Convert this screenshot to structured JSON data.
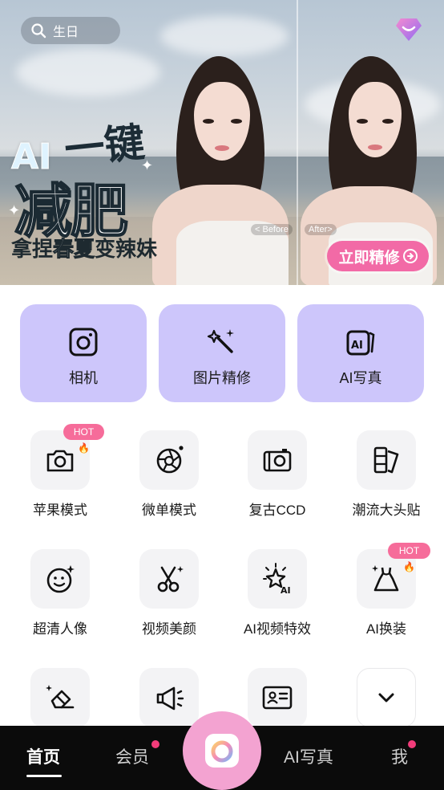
{
  "search": {
    "placeholder": "生日",
    "icon": "search-icon"
  },
  "vip": {
    "icon": "diamond-icon",
    "color": "#b86cf2"
  },
  "banner": {
    "headline_ai": "AI",
    "headline_jian": "一键",
    "headline_main": "减肥",
    "headline_sub_a": "拿捏",
    "headline_sub_b": "春夏",
    "headline_sub_c": "变",
    "headline_sub_d": "辣妹",
    "before_tag": "< Before",
    "after_tag": "After>",
    "cta": "立即精修",
    "cta_color": "#f26aa6"
  },
  "feature_cards": [
    {
      "label": "相机",
      "icon": "camera-icon"
    },
    {
      "label": "图片精修",
      "icon": "magic-wand-icon"
    },
    {
      "label": "AI写真",
      "icon": "ai-portrait-icon"
    }
  ],
  "card_color": "#cdc6fb",
  "tools": [
    {
      "label": "苹果模式",
      "icon": "camera-icon",
      "badge": "HOT🔥"
    },
    {
      "label": "微单模式",
      "icon": "aperture-icon",
      "badge": ""
    },
    {
      "label": "复古CCD",
      "icon": "retro-camera-icon",
      "badge": ""
    },
    {
      "label": "潮流大头贴",
      "icon": "photo-strip-icon",
      "badge": ""
    },
    {
      "label": "超清人像",
      "icon": "smiley-face-icon",
      "badge": ""
    },
    {
      "label": "视频美颜",
      "icon": "scissors-icon",
      "badge": ""
    },
    {
      "label": "AI视频特效",
      "icon": "ai-star-icon",
      "badge": ""
    },
    {
      "label": "AI换装",
      "icon": "dress-icon",
      "badge": "HOT🔥"
    }
  ],
  "tools_row3_icons": [
    "eraser-icon",
    "megaphone-icon",
    "id-card-icon",
    "chevron-down-icon"
  ],
  "badge_color": "#f66c9a",
  "tabbar": {
    "home": "首页",
    "member": "会员",
    "ai_portrait": "AI写真",
    "me": "我",
    "center_icon": "camera-icon",
    "center_color": "#f3a3d1",
    "dot_color": "#f23c7a"
  }
}
